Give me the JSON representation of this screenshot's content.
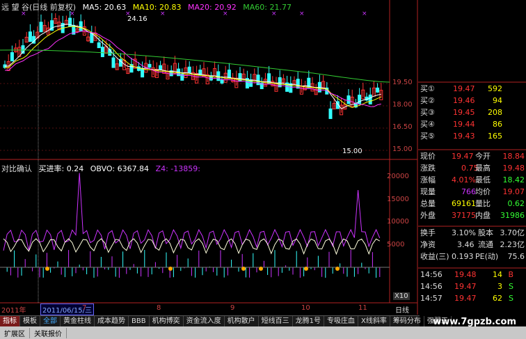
{
  "header": {
    "title": "远 望 谷(日线 前复权)",
    "ma5": "MA5: 20.63",
    "ma10": "MA10: 20.83",
    "ma20": "MA20: 20.92",
    "ma60": "MA60: 21.77",
    "high_label": "24.16",
    "low_label": "15.00"
  },
  "indicator": {
    "title": "对比确认",
    "buy_rate": "买进率: 0.24",
    "obvo": "OBVO: 6367.84",
    "z4": "Z4: -13859:"
  },
  "price_axis": [
    "19.50",
    "18.00",
    "16.50",
    "15.00"
  ],
  "ind_axis": [
    "20000",
    "15000",
    "10000",
    "5000"
  ],
  "x10": "X10",
  "dates": {
    "year": "2011年",
    "cursor": "2011/06/15/三",
    "months": [
      "7",
      "8",
      "9",
      "10",
      "11"
    ],
    "period": "日线"
  },
  "quotes": {
    "bids": [
      {
        "label": "买①",
        "price": "19.47",
        "vol": "592"
      },
      {
        "label": "买②",
        "price": "19.46",
        "vol": "94"
      },
      {
        "label": "买③",
        "price": "19.45",
        "vol": "208"
      },
      {
        "label": "买④",
        "price": "19.44",
        "vol": "86"
      },
      {
        "label": "买⑤",
        "price": "19.43",
        "vol": "165"
      }
    ],
    "stats": [
      {
        "l1": "现价",
        "v1": "19.47",
        "l2": "今开",
        "v2": "18.84"
      },
      {
        "l1": "涨跌",
        "v1": "0.75",
        "l2": "最高",
        "v2": "19.48"
      },
      {
        "l1": "涨幅",
        "v1": "4.01%",
        "l2": "最低",
        "v2": "18.42"
      },
      {
        "l1": "现量",
        "v1": "766",
        "l2": "均价",
        "v2": "19.07"
      },
      {
        "l1": "总量",
        "v1": "69161",
        "l2": "量比",
        "v2": "0.62"
      },
      {
        "l1": "外盘",
        "v1": "37175",
        "l2": "内盘",
        "v2": "31986"
      }
    ],
    "stats2": [
      {
        "l1": "换手",
        "v1": "3.10%",
        "l2": "股本",
        "v2": "3.70亿"
      },
      {
        "l1": "净资",
        "v1": "3.46",
        "l2": "流通",
        "v2": "2.23亿"
      },
      {
        "l1": "收益(三)",
        "v1": "0.193",
        "l2": "PE(动)",
        "v2": "75.6"
      }
    ],
    "ticks": [
      {
        "time": "14:56",
        "price": "19.48",
        "vol": "14",
        "bs": "B"
      },
      {
        "time": "14:56",
        "price": "19.47",
        "vol": "3",
        "bs": "S"
      },
      {
        "time": "14:57",
        "price": "19.47",
        "vol": "62",
        "bs": "S"
      }
    ]
  },
  "tabs": [
    "指标",
    "模板",
    "全部",
    "黄金柱线",
    "成本趋势",
    "BBB",
    "机构博奕",
    "资金流入度",
    "机构散户",
    "短线百三",
    "龙腾1号",
    "专吸庄血",
    "X线斜率",
    "筹码分布",
    "强弱王"
  ],
  "bottom": [
    "扩展区",
    "关联报价"
  ],
  "watermark": "www.7gpzb.com",
  "colors": {
    "up": "#ff3333",
    "down": "#33ffff",
    "ma5": "#ffffff",
    "ma10": "#ffff00",
    "ma20": "#ff33ff",
    "ma60": "#33cc33",
    "axis": "#b22222"
  }
}
